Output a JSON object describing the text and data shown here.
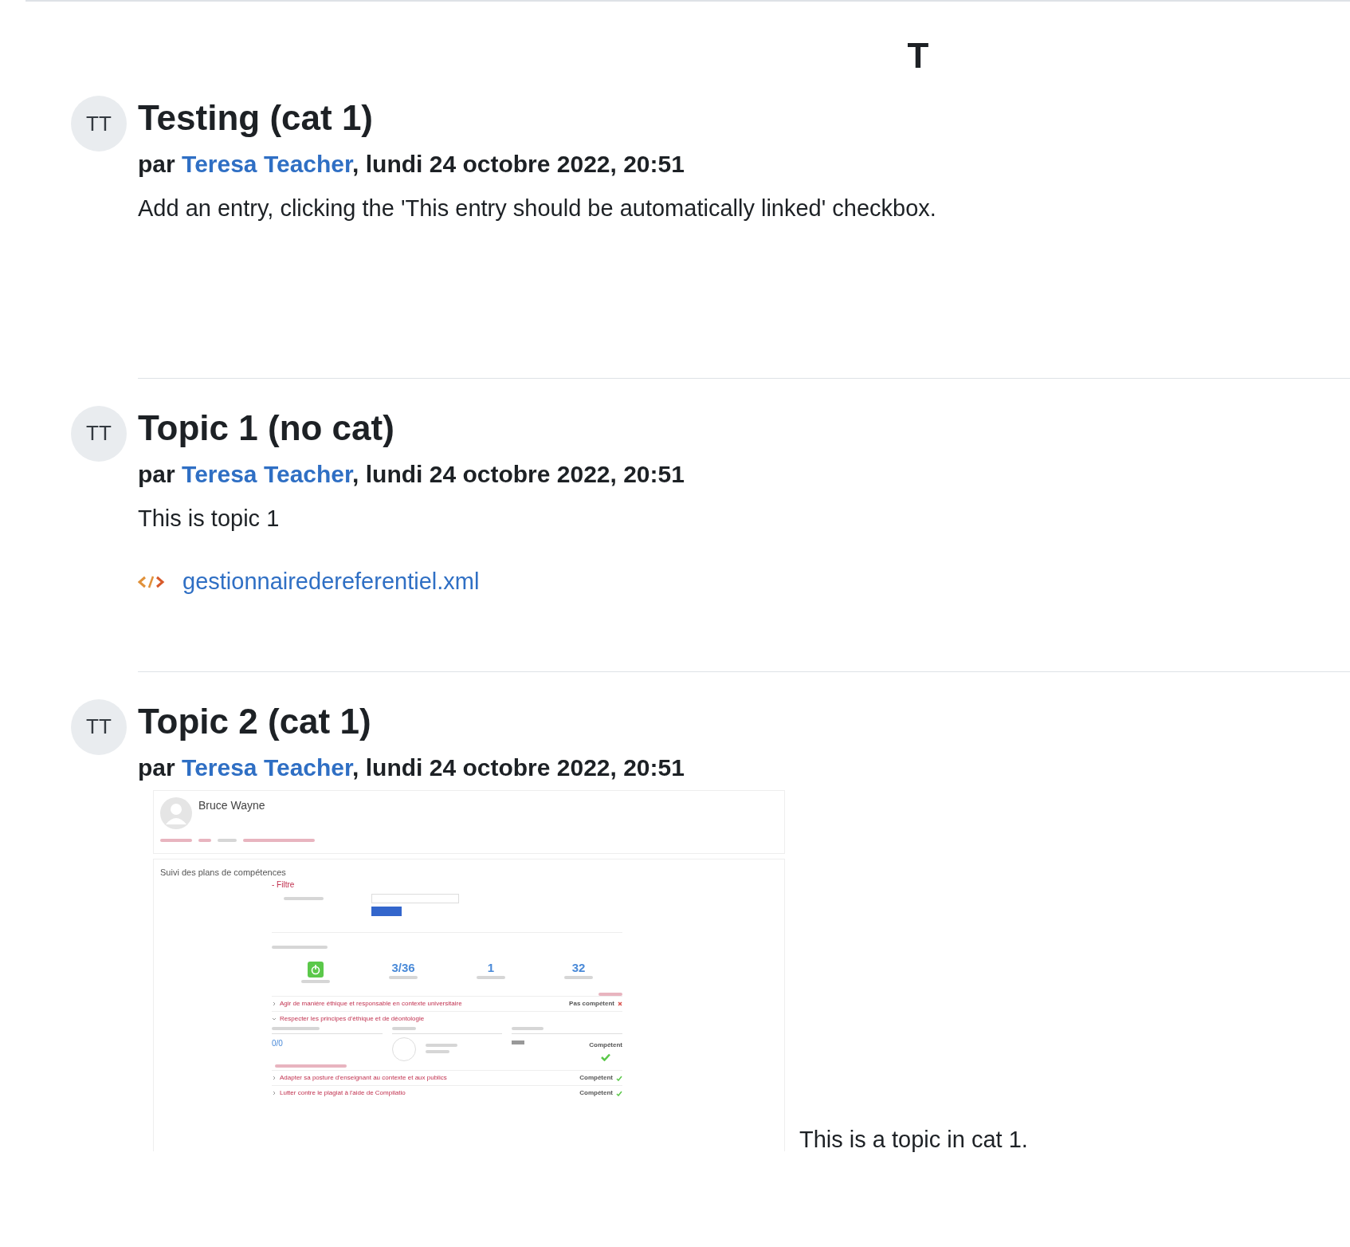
{
  "header_letter": "T",
  "entries": [
    {
      "avatar": "TT",
      "title": "Testing (cat 1)",
      "by_prefix": "par",
      "author": "Teresa Teacher",
      "date": ", lundi 24 octobre 2022, 20:51",
      "body": "Add an entry, clicking the 'This entry should be automatically linked' checkbox."
    },
    {
      "avatar": "TT",
      "title": "Topic 1 (no cat)",
      "by_prefix": "par",
      "author": "Teresa Teacher",
      "date": ", lundi 24 octobre 2022, 20:51",
      "body": "This is topic 1",
      "attachment": {
        "name": "gestionnairedereferentiel.xml"
      }
    },
    {
      "avatar": "TT",
      "title": "Topic 2 (cat 1)",
      "by_prefix": "par",
      "author": "Teresa Teacher",
      "date": ", lundi 24 octobre 2022, 20:51",
      "body": "This is a topic in cat 1.",
      "embedded_screenshot": {
        "user": "Bruce Wayne",
        "heading": "Suivi des plans de compétences",
        "filter": "- Filtre",
        "stats": [
          {
            "kind": "status"
          },
          {
            "kind": "number",
            "value": "3/36"
          },
          {
            "kind": "number",
            "value": "1"
          },
          {
            "kind": "number",
            "value": "32"
          }
        ],
        "competencies": [
          {
            "name": "Agir de manière éthique et responsable en contexte universitaire",
            "status": "Pas compétent",
            "proficient": false,
            "expanded": false
          },
          {
            "name": "Respecter les principes d'éthique et de déontologie",
            "expanded": true,
            "details": {
              "total": "0/0",
              "final_status": "Compétent"
            }
          },
          {
            "name": "Adapter sa posture d'enseignant au contexte et aux publics",
            "status": "Compétent",
            "proficient": true,
            "expanded": false
          },
          {
            "name": "Lutter contre le plagiat à l'aide de Compilatio",
            "status": "Compétent",
            "proficient": true,
            "expanded": false
          }
        ]
      }
    }
  ]
}
